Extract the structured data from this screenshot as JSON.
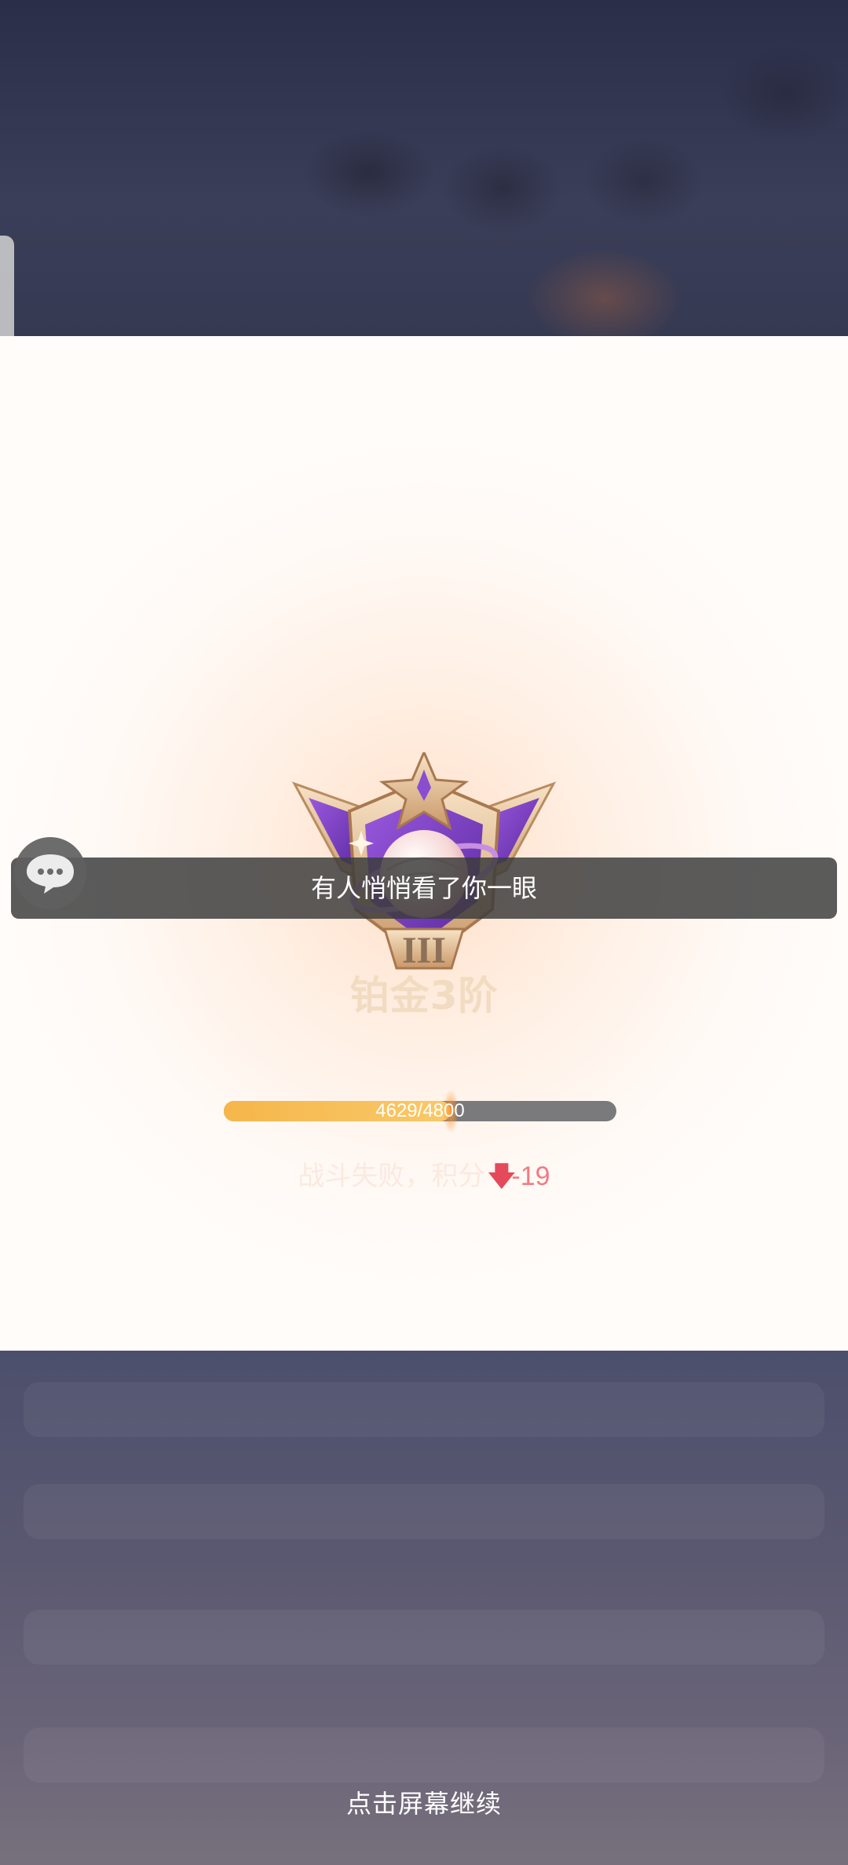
{
  "rank": {
    "name": "铂金3阶",
    "tier_numeral": "III"
  },
  "progress": {
    "current": 4629,
    "max": 4800,
    "label": "4629/4800"
  },
  "result": {
    "label": "战斗失败，积分",
    "delta": "-19",
    "arrow_icon": "down-arrow-icon"
  },
  "toast": {
    "message": "有人悄悄看了你一眼",
    "icon": "chat-bubble-icon"
  },
  "continue_hint": "点击屏幕继续",
  "colors": {
    "progress_fill": "#f6b64a",
    "progress_track": "#7a7a7d",
    "delta_red": "#f27a85",
    "badge_purple": "#7a3fc0",
    "badge_gold": "#e3b98a"
  }
}
